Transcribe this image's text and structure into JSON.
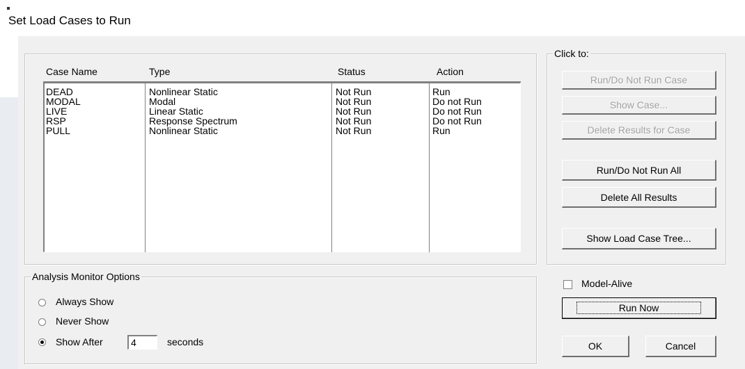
{
  "window": {
    "title": "Set Load Cases to Run"
  },
  "cases": {
    "headers": {
      "name": "Case Name",
      "type": "Type",
      "status": "Status",
      "action": "Action"
    },
    "rows": [
      {
        "name": "DEAD",
        "type": "Nonlinear Static",
        "status": "Not Run",
        "action": "Run"
      },
      {
        "name": "MODAL",
        "type": "Modal",
        "status": "Not Run",
        "action": "Do not Run"
      },
      {
        "name": "LIVE",
        "type": "Linear Static",
        "status": "Not Run",
        "action": "Do not Run"
      },
      {
        "name": "RSP",
        "type": "Response Spectrum",
        "status": "Not Run",
        "action": "Do not Run"
      },
      {
        "name": "PULL",
        "type": "Nonlinear Static",
        "status": "Not Run",
        "action": "Run"
      }
    ]
  },
  "click_to": {
    "legend": "Click to:",
    "run_do_not_run_case": "Run/Do Not Run Case",
    "show_case": "Show Case...",
    "delete_results_for_case": "Delete Results for Case",
    "run_do_not_run_all": "Run/Do Not Run All",
    "delete_all_results": "Delete All Results",
    "show_load_case_tree": "Show Load Case Tree..."
  },
  "monitor": {
    "legend": "Analysis Monitor Options",
    "always_show": "Always Show",
    "never_show": "Never Show",
    "show_after": "Show After",
    "seconds_value": "4",
    "seconds_label": "seconds",
    "selected": "Show After"
  },
  "footer": {
    "model_alive": "Model-Alive",
    "model_alive_checked": false,
    "run_now": "Run Now",
    "ok": "OK",
    "cancel": "Cancel"
  },
  "colors": {
    "dialog_bg": "#f0f0f0",
    "disabled_text": "#a0a0a0"
  }
}
